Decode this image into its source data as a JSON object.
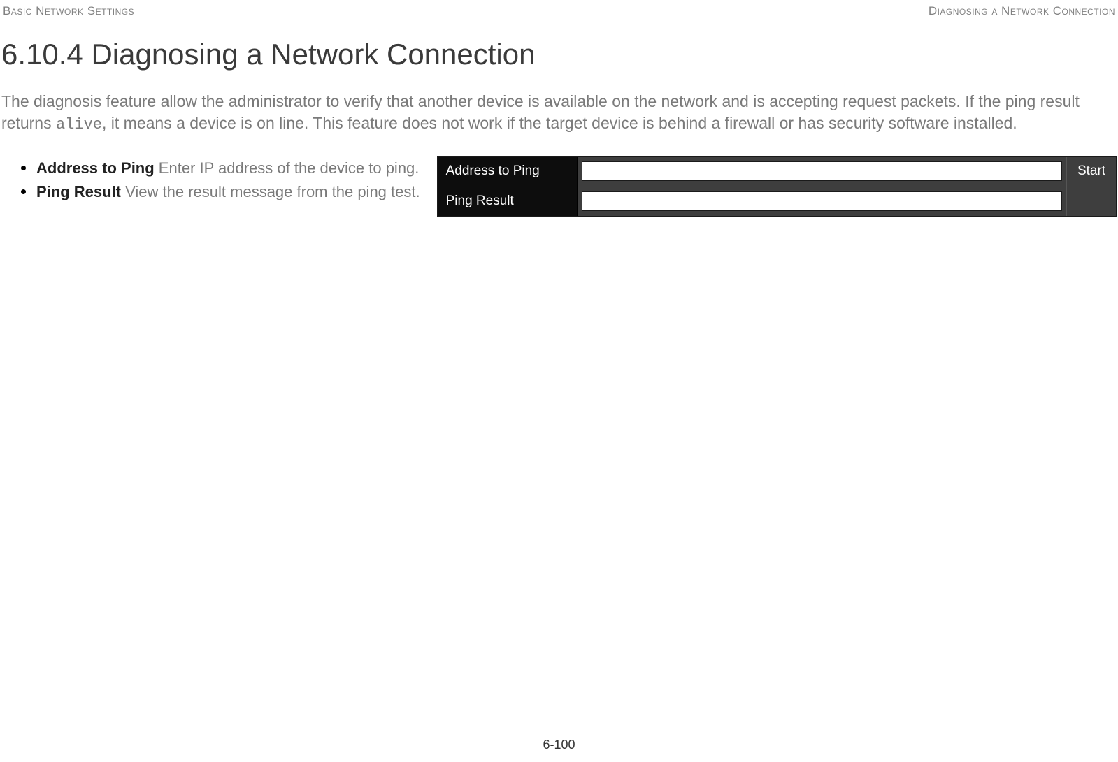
{
  "header": {
    "left": "Basic Network Settings",
    "right": "Diagnosing a Network Connection"
  },
  "title": "6.10.4 Diagnosing a Network Connection",
  "intro": {
    "part1": "The diagnosis feature allow the administrator to verify that another device is available on the network and is accepting request packets. If the ping result returns ",
    "code": "alive",
    "part2": ", it means a device is on line. This feature does not work if the target device is behind a firewall or has security software installed."
  },
  "fields": [
    {
      "label": "Address to Ping",
      "desc": "  Enter IP address of the device to ping."
    },
    {
      "label": "Ping Result",
      "desc": "  View the result message from the ping test."
    }
  ],
  "panel": {
    "row1_label": "Address to Ping",
    "row1_value": "",
    "row1_button": "Start",
    "row2_label": "Ping Result",
    "row2_value": ""
  },
  "footer": "6-100"
}
